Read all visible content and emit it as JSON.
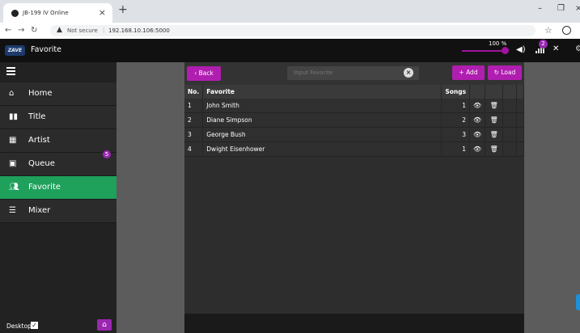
{
  "browser": {
    "tab_title": "JB-199 IV Online",
    "security": "Not secure",
    "url": "192.168.10.106:5000"
  },
  "app": {
    "logo_text": "ZAVE",
    "title": "Favorite",
    "volume": {
      "label": "100 %",
      "level": 1.0
    },
    "signal_badge": "2"
  },
  "sidebar": {
    "items": [
      {
        "icon": "home-icon",
        "label": "Home"
      },
      {
        "icon": "book-icon",
        "label": "Title"
      },
      {
        "icon": "table-icon",
        "label": "Artist"
      },
      {
        "icon": "queue-icon",
        "label": "Queue",
        "badge": "5"
      },
      {
        "icon": "users-icon",
        "label": "Favorite",
        "active": true
      },
      {
        "icon": "sliders-icon",
        "label": "Mixer"
      }
    ],
    "desktop_label": "Desktop",
    "desktop_checked": true
  },
  "toolbar": {
    "back_label": "Back",
    "search_placeholder": "Input Favorite",
    "add_label": "Add",
    "load_label": "Load"
  },
  "table": {
    "headers": [
      "No.",
      "Favorite",
      "Songs"
    ],
    "rows": [
      {
        "no": "1",
        "name": "John Smith",
        "songs": "1"
      },
      {
        "no": "2",
        "name": "Diane Simpson",
        "songs": "2"
      },
      {
        "no": "3",
        "name": "George Bush",
        "songs": "3"
      },
      {
        "no": "4",
        "name": "Dwight Eisenhower",
        "songs": "1"
      }
    ]
  }
}
